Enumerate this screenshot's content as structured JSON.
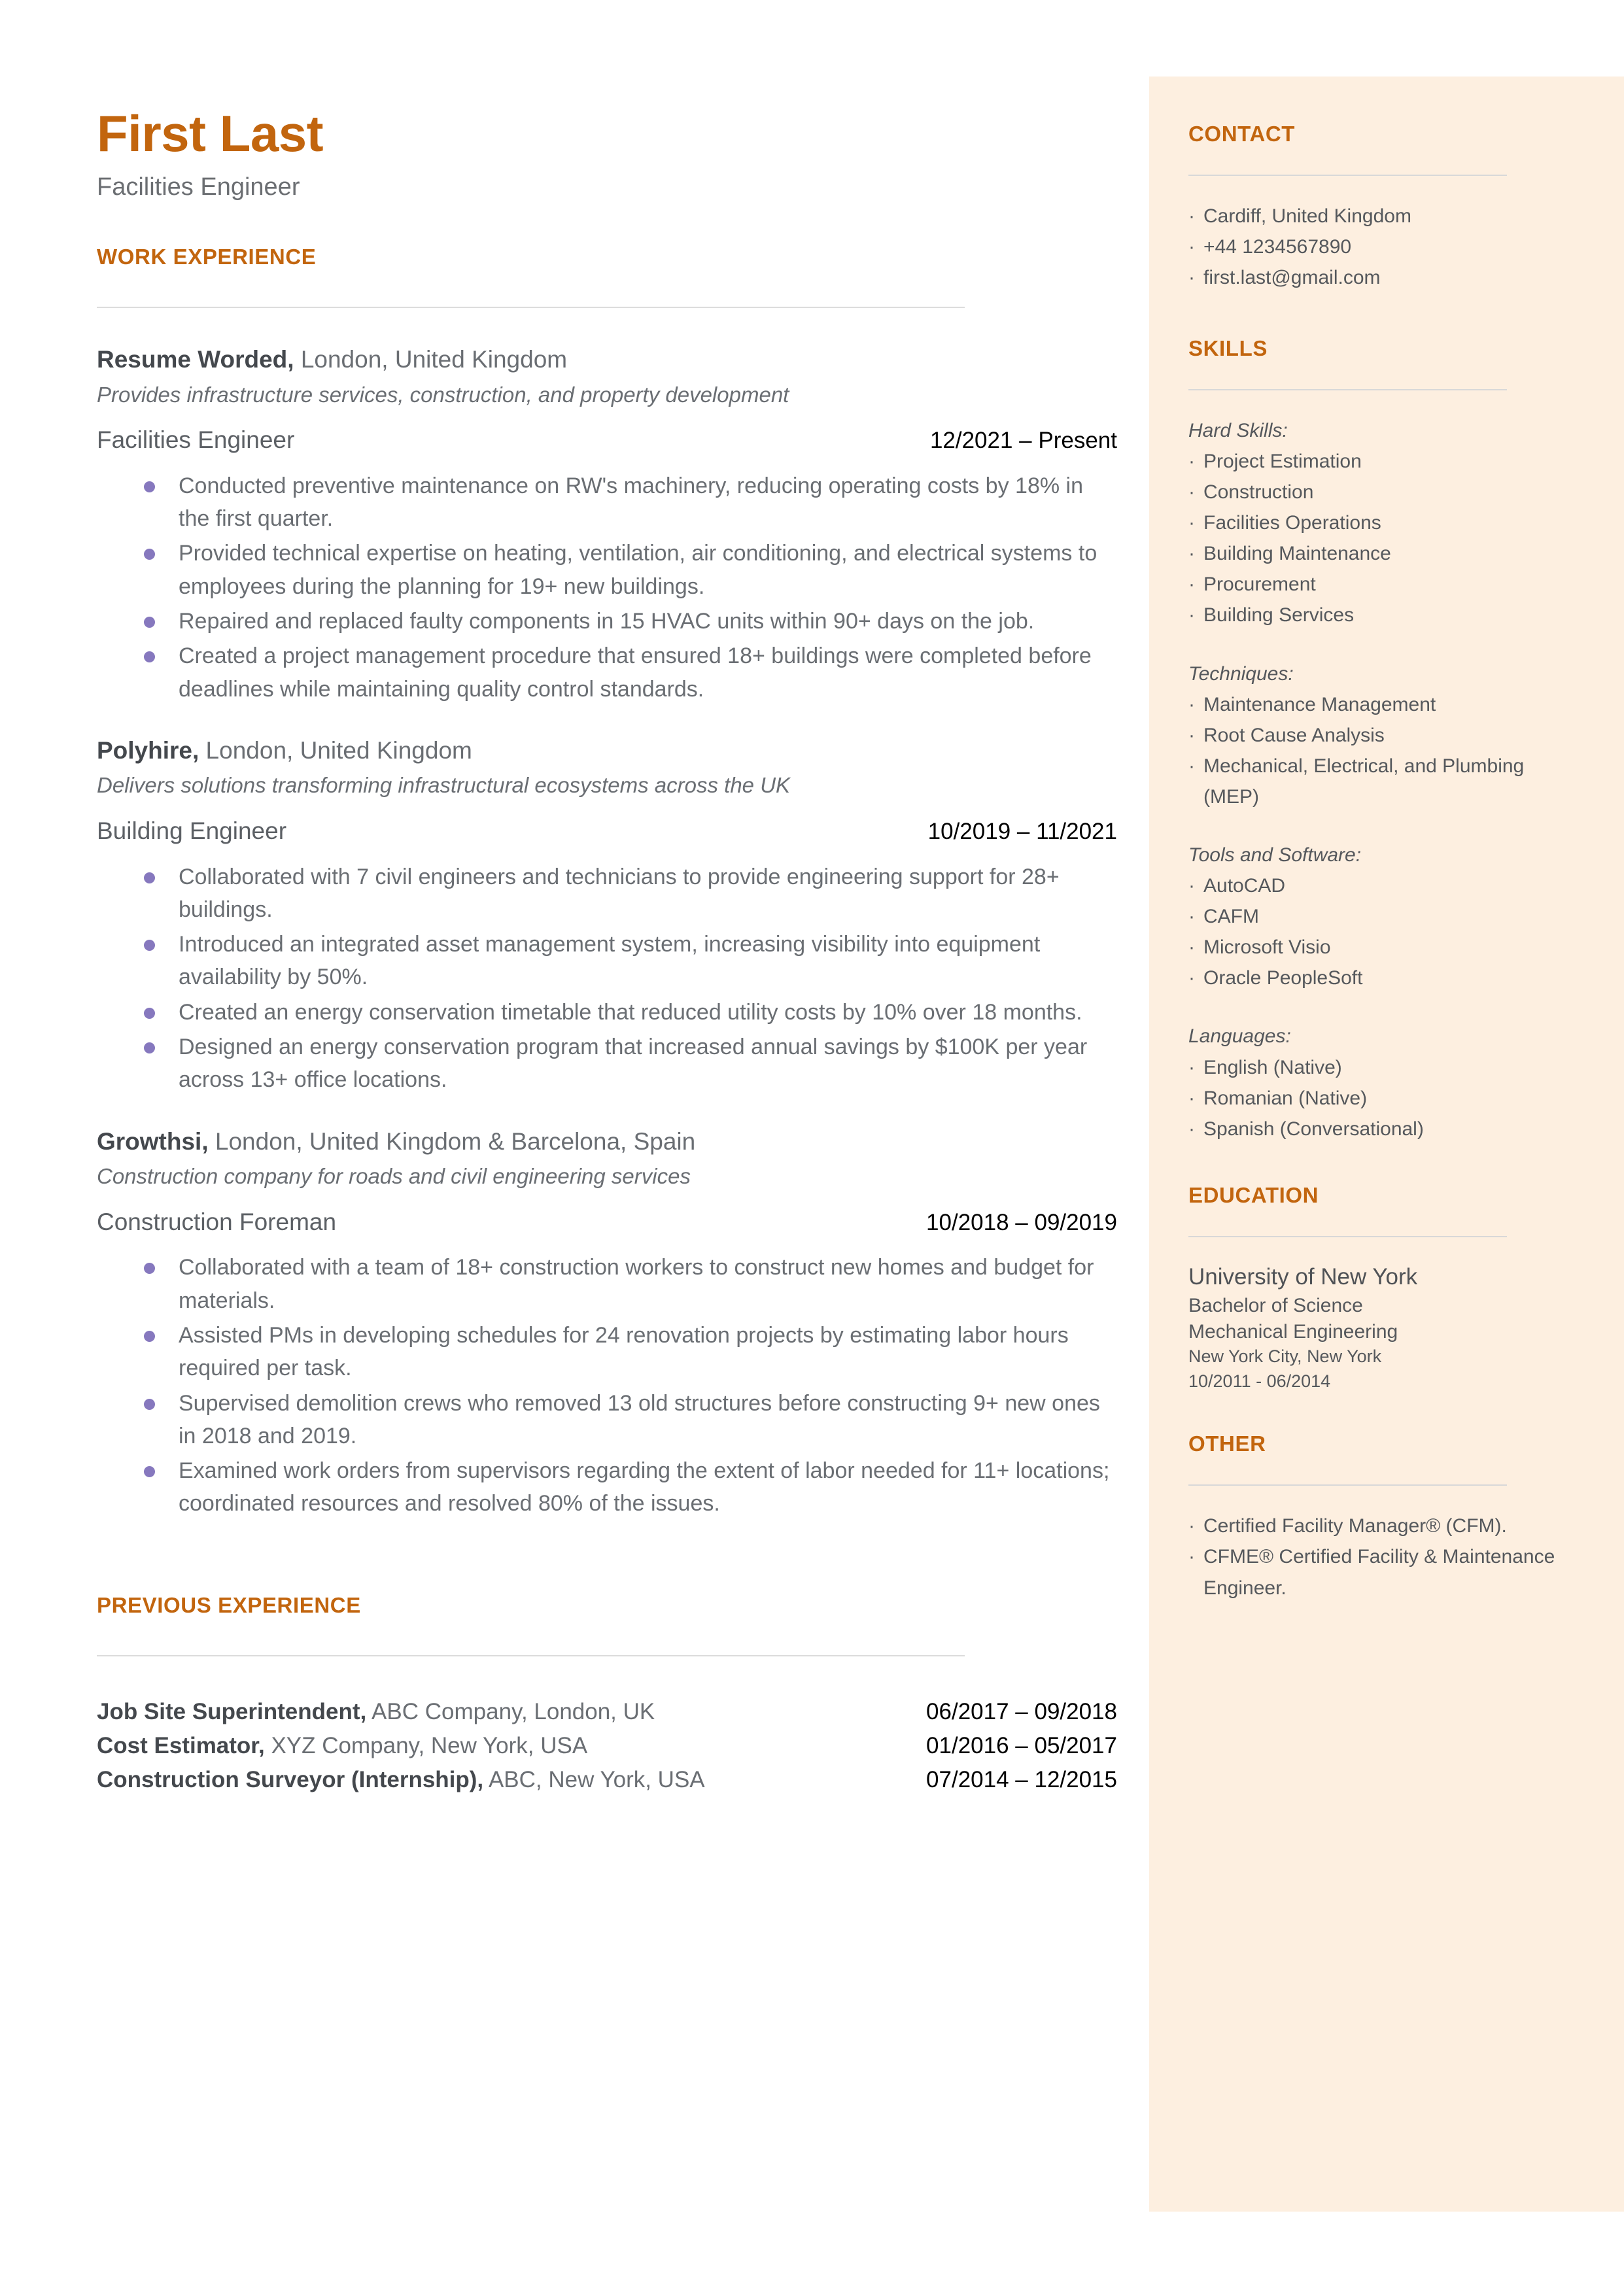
{
  "colors": {
    "accent": "#C2650E",
    "sidebar_bg": "#FDEFE0",
    "bullet": "#8678BE",
    "body_text": "#6A6E73",
    "rule": "#DCDCDC"
  },
  "header": {
    "name": "First Last",
    "role": "Facilities Engineer"
  },
  "work_experience": {
    "heading": "WORK EXPERIENCE",
    "jobs": [
      {
        "company": "Resume Worded,",
        "location": " London, United Kingdom",
        "blurb": "Provides infrastructure services, construction, and property development",
        "title": "Facilities Engineer",
        "dates": "12/2021 – Present",
        "bullets": [
          "Conducted preventive maintenance on RW's machinery, reducing operating costs by 18% in the first quarter.",
          "Provided technical expertise on heating, ventilation, air conditioning, and electrical systems to employees during the planning for 19+ new buildings.",
          "Repaired and replaced faulty components in 15 HVAC units within 90+ days on the job.",
          "Created a project management procedure that ensured 18+ buildings were completed before deadlines while maintaining quality control standards."
        ]
      },
      {
        "company": "Polyhire,",
        "location": " London, United Kingdom",
        "blurb": "Delivers solutions transforming infrastructural ecosystems across the UK",
        "title": "Building Engineer",
        "dates": "10/2019 – 11/2021",
        "bullets": [
          "Collaborated with 7 civil engineers and technicians to provide engineering support for 28+ buildings.",
          "Introduced an integrated asset management system, increasing visibility into equipment availability by 50%.",
          "Created an energy conservation timetable that reduced utility costs by 10% over 18 months.",
          "Designed an energy conservation program that increased annual savings by $100K per year across 13+ office locations."
        ]
      },
      {
        "company": "Growthsi,",
        "location": " London, United Kingdom & Barcelona, Spain",
        "blurb": "Construction company for roads and civil engineering services",
        "title": "Construction Foreman",
        "dates": "10/2018 – 09/2019",
        "bullets": [
          "Collaborated with a team of 18+ construction workers to construct new homes and budget for materials.",
          "Assisted PMs in developing schedules for 24 renovation projects by estimating labor hours required per task.",
          "Supervised demolition crews who removed 13 old structures before constructing 9+ new ones in 2018 and 2019.",
          "Examined work orders from supervisors regarding the extent of labor needed for 11+ locations; coordinated resources and resolved 80% of the issues."
        ]
      }
    ]
  },
  "previous_experience": {
    "heading": "PREVIOUS EXPERIENCE",
    "rows": [
      {
        "title": "Job Site Superintendent,",
        "detail": " ABC Company, London, UK",
        "dates": "06/2017 – 09/2018"
      },
      {
        "title": "Cost Estimator,",
        "detail": " XYZ Company, New York, USA",
        "dates": "01/2016 – 05/2017"
      },
      {
        "title": "Construction Surveyor (Internship),",
        "detail": " ABC, New York, USA",
        "dates": "07/2014 – 12/2015"
      }
    ]
  },
  "sidebar": {
    "contact": {
      "heading": "CONTACT",
      "items": [
        "Cardiff, United Kingdom",
        "+44 1234567890",
        "first.last@gmail.com"
      ]
    },
    "skills": {
      "heading": "SKILLS",
      "groups": [
        {
          "label": "Hard Skills:",
          "items": [
            "Project Estimation",
            "Construction",
            "Facilities Operations",
            "Building Maintenance",
            "Procurement",
            "Building Services"
          ]
        },
        {
          "label": "Techniques:",
          "items": [
            "Maintenance Management",
            "Root Cause Analysis",
            "Mechanical, Electrical, and Plumbing (MEP)"
          ]
        },
        {
          "label": "Tools and Software:",
          "items": [
            "AutoCAD",
            "CAFM",
            "Microsoft Visio",
            "Oracle PeopleSoft"
          ]
        },
        {
          "label": "Languages:",
          "items": [
            "English (Native)",
            "Romanian (Native)",
            "Spanish (Conversational)"
          ]
        }
      ]
    },
    "education": {
      "heading": "EDUCATION",
      "school": "University of New York",
      "degree": "Bachelor of Science",
      "field": "Mechanical Engineering",
      "location": "New York City, New York",
      "dates": "10/2011 - 06/2014"
    },
    "other": {
      "heading": "OTHER",
      "items": [
        "Certified Facility Manager® (CFM).",
        "CFME® Certified Facility & Maintenance Engineer."
      ]
    }
  }
}
